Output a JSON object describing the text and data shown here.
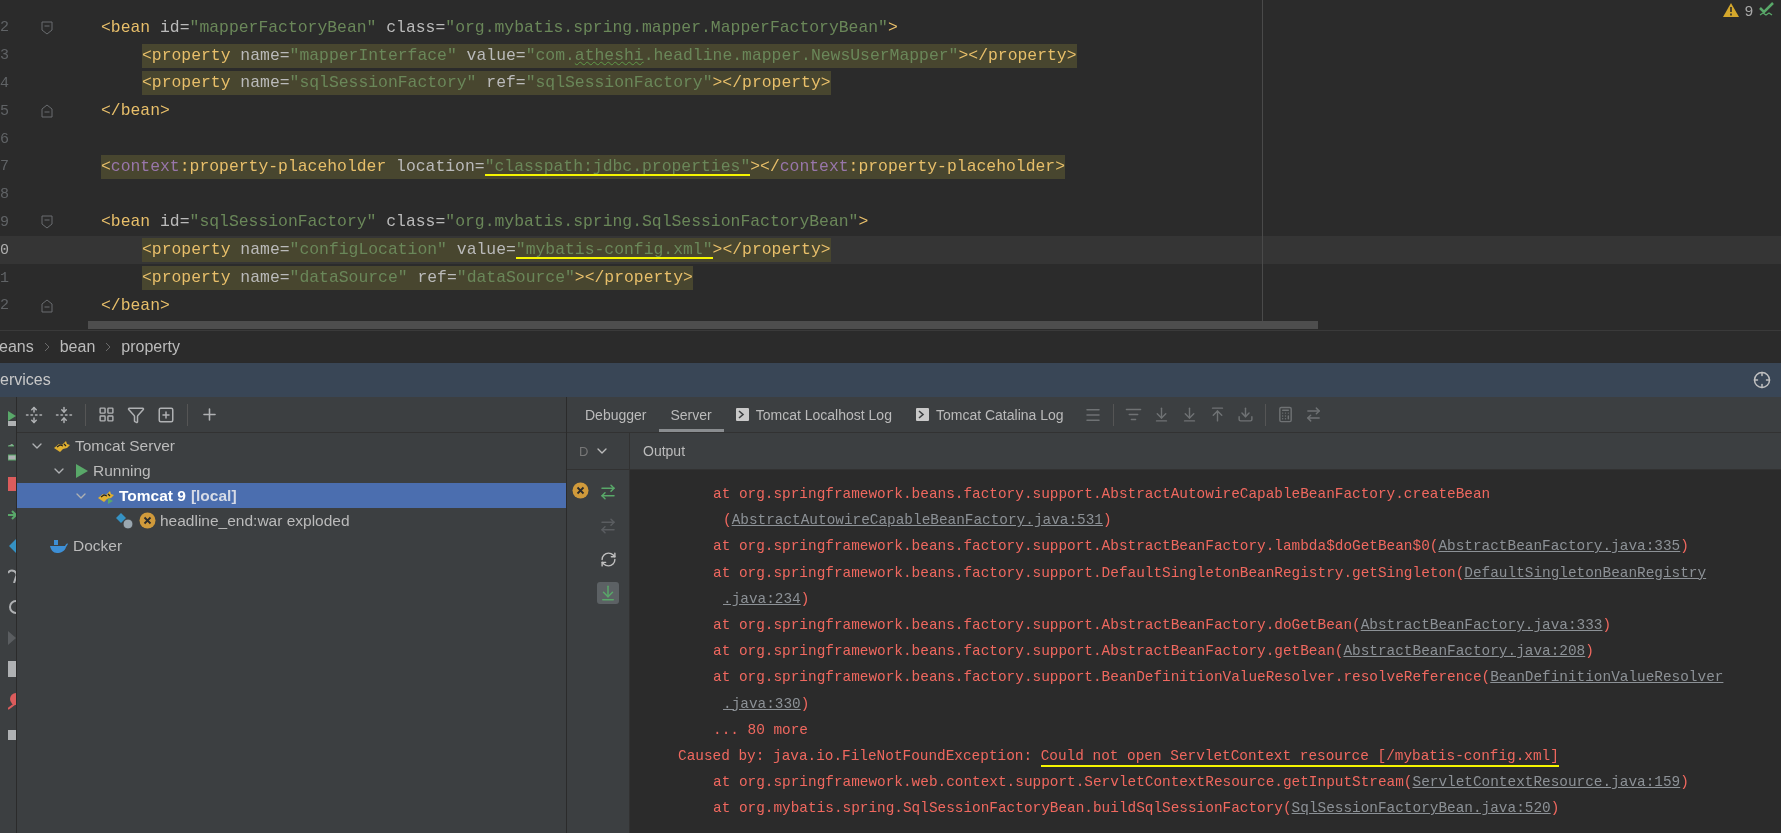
{
  "editor": {
    "inspection": {
      "warnings": "9"
    },
    "lines": [
      {
        "number": "2",
        "fold_open": true,
        "highlighted": false,
        "segments": [
          {
            "kind": "tag",
            "text": "<bean"
          },
          {
            "kind": "attr",
            "text": " id="
          },
          {
            "kind": "value",
            "text": "\"mapperFactoryBean\""
          },
          {
            "kind": "attr",
            "text": " class="
          },
          {
            "kind": "value",
            "text": "\"org.mybatis.spring.mapper.MapperFactoryBean\""
          },
          {
            "kind": "tag",
            "text": ">"
          }
        ],
        "children": [
          {
            "number": "3",
            "highlighted": true,
            "segments": [
              {
                "kind": "tag",
                "text": "<property"
              },
              {
                "kind": "attr",
                "text": " name="
              },
              {
                "kind": "value",
                "text": "\"mapperInterface\""
              },
              {
                "kind": "attr",
                "text": " value="
              },
              {
                "kind": "value",
                "text": "\"com."
              },
              {
                "kind": "value",
                "text": "atheshi",
                "misspelled": true
              },
              {
                "kind": "value",
                "text": ".headline.mapper.NewsUserMapper\""
              },
              {
                "kind": "tag",
                "text": "></property>"
              }
            ]
          },
          {
            "number": "4",
            "highlighted": true,
            "segments": [
              {
                "kind": "tag",
                "text": "<property"
              },
              {
                "kind": "attr",
                "text": " name="
              },
              {
                "kind": "value",
                "text": "\"sqlSessionFactory\""
              },
              {
                "kind": "attr",
                "text": " ref="
              },
              {
                "kind": "value",
                "text": "\"sqlSessionFactory\""
              },
              {
                "kind": "tag",
                "text": "></property>"
              }
            ]
          }
        ]
      },
      {
        "number": "5",
        "fold_close": true,
        "highlighted": false,
        "segments": [
          {
            "kind": "tag",
            "text": "</bean>"
          }
        ]
      },
      {
        "number": "6"
      },
      {
        "number": "7",
        "highlighted": true,
        "segments": [
          {
            "kind": "tag",
            "text": "<"
          },
          {
            "kind": "ns",
            "text": "context"
          },
          {
            "kind": "tag",
            "text": ":property-placeholder"
          },
          {
            "kind": "attr",
            "text": " location="
          },
          {
            "kind": "value",
            "text": "\"classpath:jdbc.properties\"",
            "underlined": true
          },
          {
            "kind": "tag",
            "text": "></"
          },
          {
            "kind": "ns",
            "text": "context"
          },
          {
            "kind": "tag",
            "text": ":property-placeholder>"
          }
        ]
      },
      {
        "number": "8"
      },
      {
        "number": "9",
        "fold_open": true,
        "highlighted": false,
        "segments": [
          {
            "kind": "tag",
            "text": "<bean"
          },
          {
            "kind": "attr",
            "text": " id="
          },
          {
            "kind": "value",
            "text": "\"sqlSessionFactory\""
          },
          {
            "kind": "attr",
            "text": " class="
          },
          {
            "kind": "value",
            "text": "\"org.mybatis.spring.SqlSessionFactoryBean\""
          },
          {
            "kind": "tag",
            "text": ">"
          }
        ],
        "children": [
          {
            "number": "0",
            "highlighted": true,
            "current": true,
            "segments": [
              {
                "kind": "tag",
                "text": "<property"
              },
              {
                "kind": "attr",
                "text": " name="
              },
              {
                "kind": "value",
                "text": "\"configLocation\""
              },
              {
                "kind": "attr",
                "text": " value="
              },
              {
                "kind": "value",
                "text": "\"mybatis-config.xml\"",
                "underlined": true
              },
              {
                "kind": "tag",
                "text": "></property>"
              }
            ]
          },
          {
            "number": "1",
            "highlighted": true,
            "segments": [
              {
                "kind": "tag",
                "text": "<property"
              },
              {
                "kind": "attr",
                "text": " name="
              },
              {
                "kind": "value",
                "text": "\"dataSource\""
              },
              {
                "kind": "attr",
                "text": " ref="
              },
              {
                "kind": "value",
                "text": "\"dataSource\""
              },
              {
                "kind": "tag",
                "text": "></property>"
              }
            ]
          }
        ]
      },
      {
        "number": "2",
        "fold_close": true,
        "highlighted": false,
        "segments": [
          {
            "kind": "tag",
            "text": "</bean>"
          }
        ]
      }
    ]
  },
  "breadcrumb": [
    "eans",
    "bean",
    "property"
  ],
  "services": {
    "title": "ervices",
    "tree": [
      {
        "label": "Tomcat Server",
        "kind": "server",
        "expanded": true,
        "selected": false,
        "children": [
          {
            "label": "Running",
            "kind": "running",
            "expanded": true,
            "selected": false,
            "children": [
              {
                "label": "Tomcat 9",
                "suffix": "[local]",
                "kind": "instance",
                "expanded": true,
                "selected": true,
                "children": [
                  {
                    "label": "headline_end:war exploded",
                    "kind": "artifact",
                    "failed": true,
                    "selected": false
                  }
                ]
              }
            ]
          }
        ]
      },
      {
        "label": "Docker",
        "kind": "docker",
        "selected": false
      }
    ],
    "tabs": [
      {
        "label": "Debugger",
        "kind": "plain",
        "selected": false
      },
      {
        "label": "Server",
        "kind": "plain",
        "selected": true
      },
      {
        "label": "Tomcat Localhost Log",
        "kind": "log",
        "selected": false
      },
      {
        "label": "Tomcat Catalina Log",
        "kind": "log",
        "selected": false
      }
    ],
    "selector": "D",
    "output_title": "Output",
    "log": [
      {
        "kind": "frame",
        "text": "at org.springframework.beans.factory.support.AbstractAutowireCapableBeanFactory.createBean"
      },
      {
        "kind": "wrap",
        "text": "(",
        "link": "AbstractAutowireCapableBeanFactory.java:531",
        "tail": ")"
      },
      {
        "kind": "frame",
        "text": "at org.springframework.beans.factory.support.AbstractBeanFactory.lambda$doGetBean$0(",
        "link": "AbstractBeanFactory.java:335",
        "tail": ")"
      },
      {
        "kind": "frame",
        "text": "at org.springframework.beans.factory.support.DefaultSingletonBeanRegistry.getSingleton(",
        "link": "DefaultSingletonBeanRegistry"
      },
      {
        "kind": "wrap",
        "link": ".java:234",
        "tail": ")"
      },
      {
        "kind": "frame",
        "text": "at org.springframework.beans.factory.support.AbstractBeanFactory.doGetBean(",
        "link": "AbstractBeanFactory.java:333",
        "tail": ")"
      },
      {
        "kind": "frame",
        "text": "at org.springframework.beans.factory.support.AbstractBeanFactory.getBean(",
        "link": "AbstractBeanFactory.java:208",
        "tail": ")"
      },
      {
        "kind": "frame",
        "text": "at org.springframework.beans.factory.support.BeanDefinitionValueResolver.resolveReference(",
        "link": "BeanDefinitionValueResolver"
      },
      {
        "kind": "wrap",
        "link": ".java:330",
        "tail": ")"
      },
      {
        "kind": "frame",
        "text": "... 80 more"
      },
      {
        "kind": "cause",
        "text": "Caused by: java.io.FileNotFoundException: ",
        "marked": "Could not open ServletContext resource [/mybatis-config.xml]"
      },
      {
        "kind": "frame",
        "text": "at org.springframework.web.context.support.ServletContextResource.getInputStream(",
        "link": "ServletContextResource.java:159",
        "tail": ")"
      },
      {
        "kind": "frame",
        "text": "at org.mybatis.spring.SqlSessionFactoryBean.buildSqlSessionFactory(",
        "link": "SqlSessionFactoryBean.java:520",
        "tail": ")"
      }
    ]
  }
}
